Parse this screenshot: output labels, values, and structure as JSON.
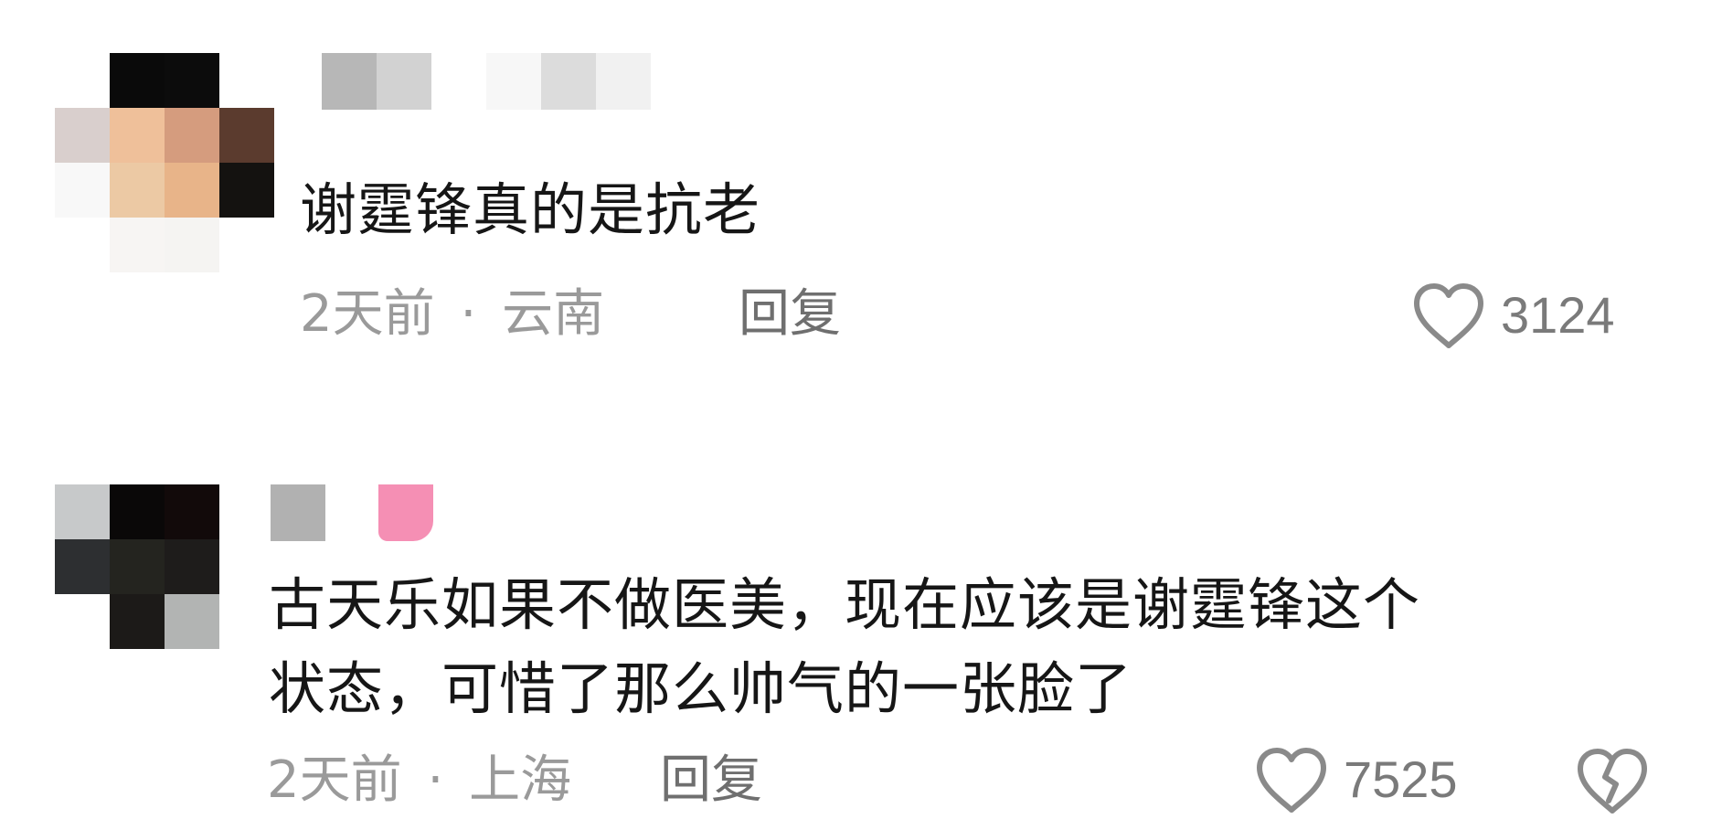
{
  "comments": [
    {
      "text": "谢霆锋真的是抗老",
      "time": "2天前",
      "separator": "·",
      "location": "云南",
      "reply_label": "回复",
      "like_count": "3124",
      "like_icon": "heart-outline-icon"
    },
    {
      "text": "古天乐如果不做医美，现在应该是谢霆锋这个\n状态，可惜了那么帅气的一张脸了",
      "time": "2天前",
      "separator": "·",
      "location": "上海",
      "reply_label": "回复",
      "like_count": "7525",
      "like_icon": "heart-outline-icon",
      "dislike_icon": "broken-heart-icon"
    }
  ],
  "colors": {
    "text": "#161616",
    "meta": "#9a9a9a",
    "reply": "#6f6f6f",
    "icon": "#8a8a8a",
    "background": "#ffffff"
  }
}
